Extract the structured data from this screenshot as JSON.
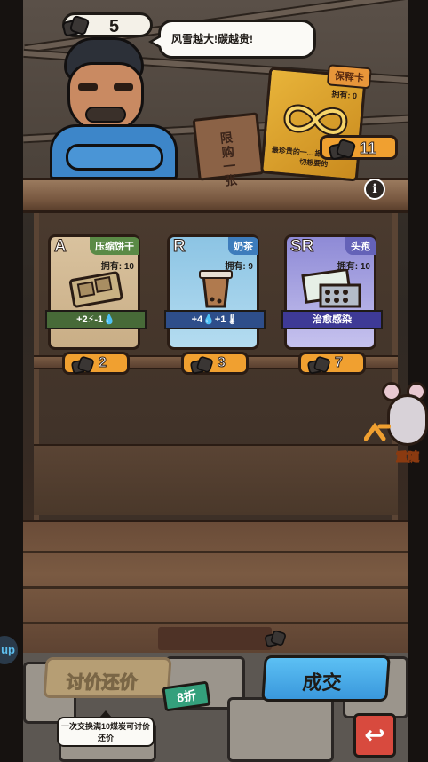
{
  "coal_count": "5",
  "speech": "风雪越大!碳越贵!",
  "sign_text": "限购一张",
  "special_card": {
    "tag": "保释卡",
    "owned": "拥有: 0",
    "desc": "最珍贵的一... 据说能兑换一切想要的",
    "price": "11"
  },
  "cards": [
    {
      "rarity": "A",
      "name": "压缩饼干",
      "owned": "拥有: 10",
      "effect": "+2⚡-1💧",
      "price": "2"
    },
    {
      "rarity": "R",
      "name": "奶茶",
      "owned": "拥有: 9",
      "effect": "+4💧+1🌡",
      "price": "3"
    },
    {
      "rarity": "SR",
      "name": "头孢",
      "owned": "拥有: 10",
      "effect": "治愈感染",
      "price": "7"
    }
  ],
  "refresh_label": "重随",
  "haggle_label": "讨价还价",
  "discount": "8折",
  "tip": "一次交换满10煤炭可讨价还价",
  "deal_label": "成交",
  "side_tab": "up",
  "colors": {
    "accent_blue": "#3a98dc",
    "price_orange": "#f0a030",
    "back_red": "#d84a3e"
  }
}
